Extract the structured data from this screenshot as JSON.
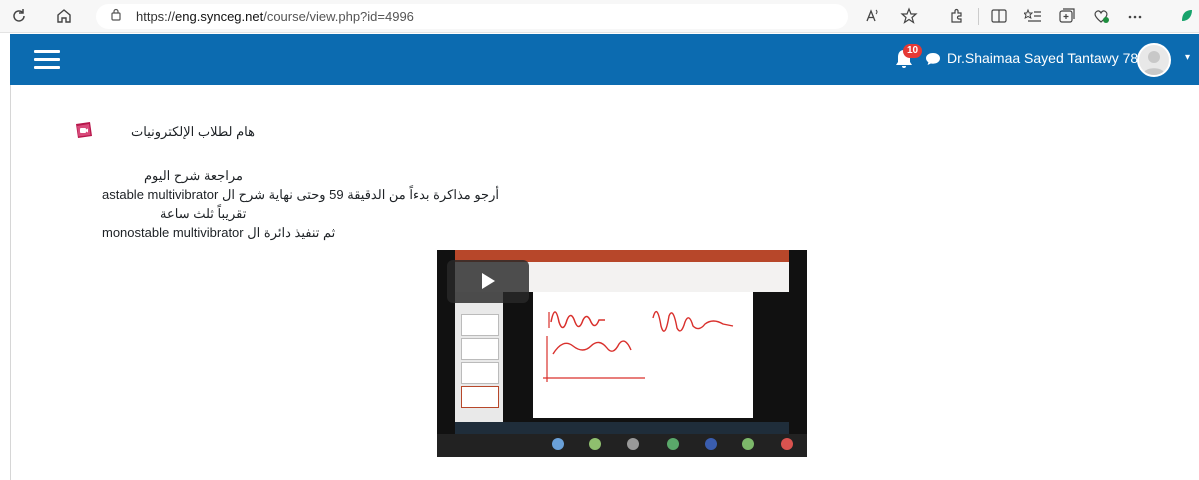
{
  "browser": {
    "url_protocol": "https://",
    "url_host": "eng.synceg.net",
    "url_path": "/course/view.php?id=4996"
  },
  "navbar": {
    "notification_count": "10",
    "user_name": "Dr.Shaimaa Sayed Tantawy 78 ."
  },
  "activity": {
    "title": "هام لطلاب الإلكترونيات",
    "lines": [
      "مراجعة شرح اليوم",
      "أرجو مذاكرة بدءاً من الدقيقة 59 وحتى نهاية شرح ال astable multivibrator",
      "تقريباً ثلث ساعة",
      "ثم تنفيذ دائرة ال monostable multivibrator"
    ]
  },
  "colors": {
    "navbar_bg": "#0c6bb0",
    "badge_bg": "#e53935"
  }
}
